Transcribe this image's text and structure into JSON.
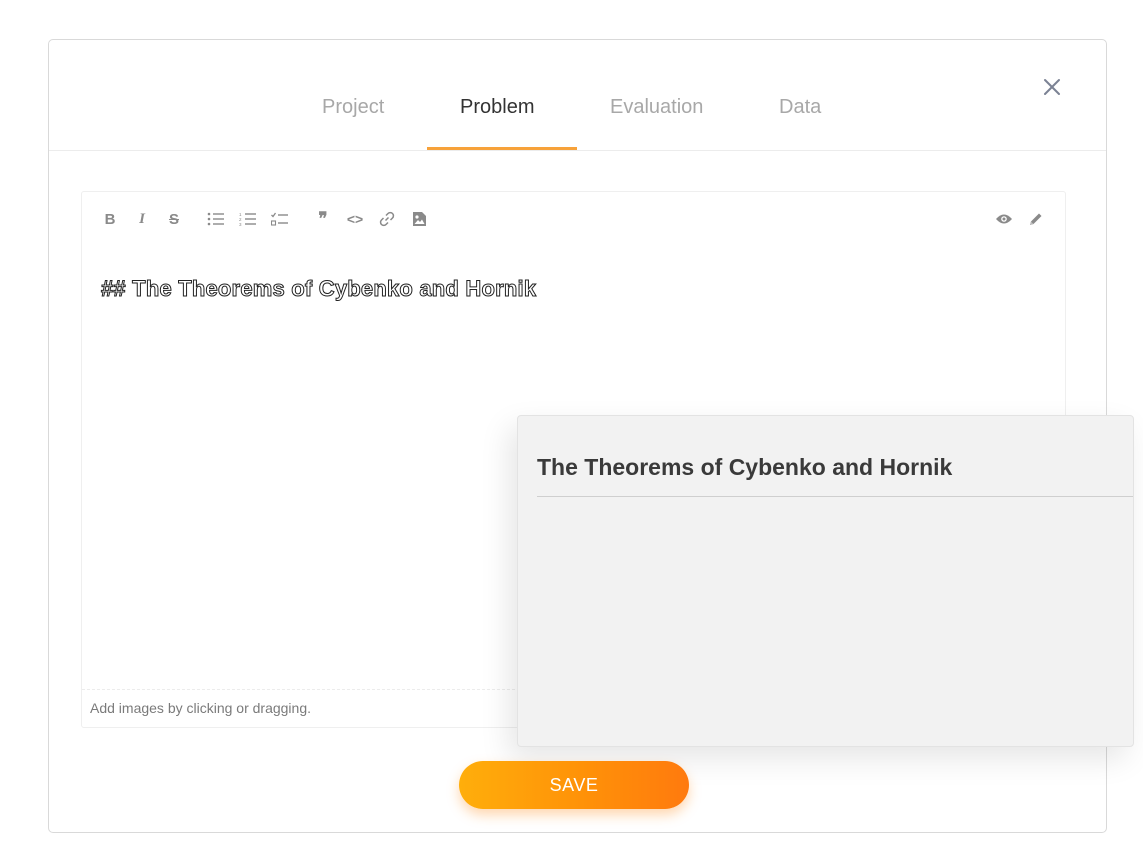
{
  "tabs": [
    {
      "label": "Project"
    },
    {
      "label": "Problem"
    },
    {
      "label": "Evaluation"
    },
    {
      "label": "Data"
    }
  ],
  "active_tab": "Problem",
  "editor": {
    "toolbar": [
      {
        "name": "bold",
        "glyph": "B"
      },
      {
        "name": "italic",
        "glyph": "I"
      },
      {
        "name": "strikethrough",
        "glyph": "S"
      },
      {
        "name": "unordered-list",
        "glyph": ""
      },
      {
        "name": "ordered-list",
        "glyph": ""
      },
      {
        "name": "checklist",
        "glyph": ""
      },
      {
        "name": "quote",
        "glyph": "❞"
      },
      {
        "name": "code",
        "glyph": "<>"
      },
      {
        "name": "link",
        "glyph": ""
      },
      {
        "name": "image",
        "glyph": ""
      },
      {
        "name": "preview",
        "glyph": ""
      },
      {
        "name": "edit",
        "glyph": ""
      }
    ],
    "content": "## The Theorems of Cybenko and Hornik",
    "footer_hint": "Add images by clicking or dragging."
  },
  "preview": {
    "heading": "The Theorems of Cybenko and Hornik"
  },
  "save_label": "SAVE",
  "colors": {
    "accent": "#f7a23a",
    "save_gradient_start": "#ffae0b",
    "save_gradient_end": "#ff7a0e",
    "preview_bg": "#f2f2f2"
  }
}
